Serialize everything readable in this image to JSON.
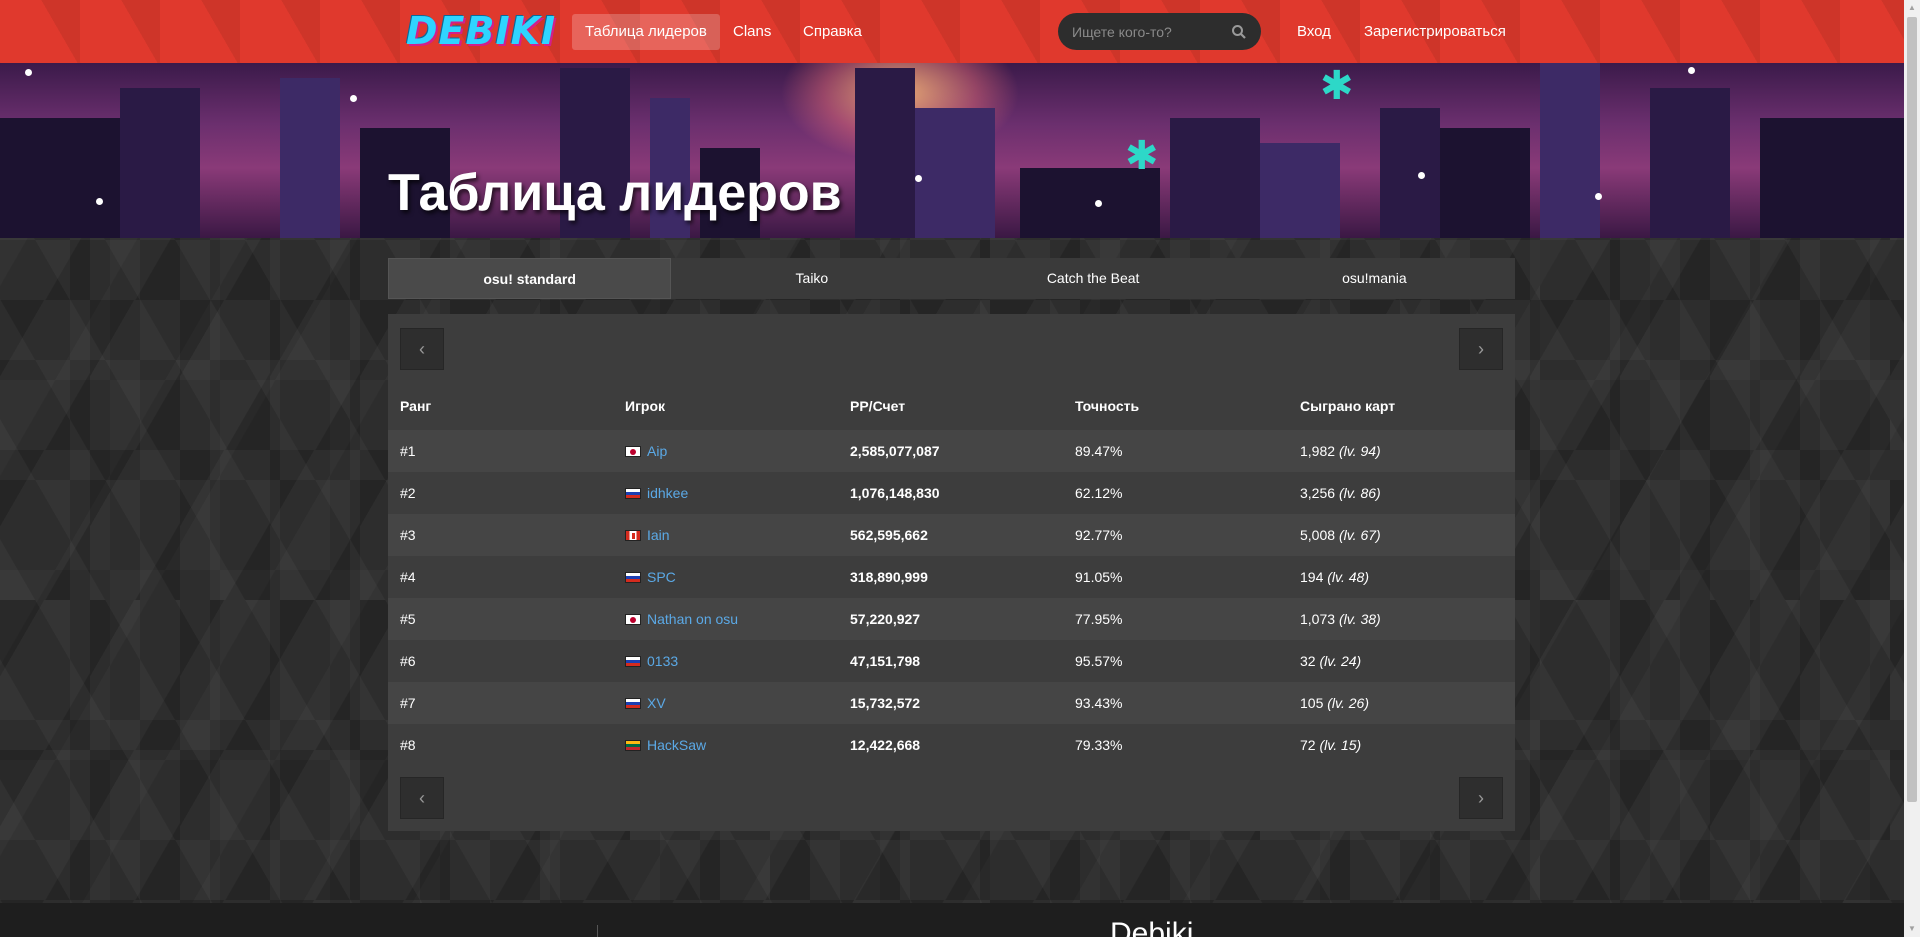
{
  "nav": {
    "logo": "DEBIKI",
    "links": [
      "Таблица лидеров",
      "Clans",
      "Справка"
    ],
    "search_placeholder": "Ищете кого-то?",
    "login": "Вход",
    "register": "Зарегистрироваться"
  },
  "hero": {
    "title": "Таблица лидеров"
  },
  "modes": [
    "osu! standard",
    "Taiko",
    "Catch the Beat",
    "osu!mania"
  ],
  "table": {
    "headers": [
      "Ранг",
      "Игрок",
      "PP/Счет",
      "Точность",
      "Сыграно карт"
    ],
    "rows": [
      {
        "rank": "#1",
        "flag": "jp",
        "player": "Aip",
        "score": "2,585,077,087",
        "accuracy": "89.47%",
        "plays": "1,982",
        "level": "(lv. 94)"
      },
      {
        "rank": "#2",
        "flag": "ru",
        "player": "idhkee",
        "score": "1,076,148,830",
        "accuracy": "62.12%",
        "plays": "3,256",
        "level": "(lv. 86)"
      },
      {
        "rank": "#3",
        "flag": "ca",
        "player": "Iain",
        "score": "562,595,662",
        "accuracy": "92.77%",
        "plays": "5,008",
        "level": "(lv. 67)"
      },
      {
        "rank": "#4",
        "flag": "ru",
        "player": "SPC",
        "score": "318,890,999",
        "accuracy": "91.05%",
        "plays": "194",
        "level": "(lv. 48)"
      },
      {
        "rank": "#5",
        "flag": "jp",
        "player": "Nathan on osu",
        "score": "57,220,927",
        "accuracy": "77.95%",
        "plays": "1,073",
        "level": "(lv. 38)"
      },
      {
        "rank": "#6",
        "flag": "ru",
        "player": "0133",
        "score": "47,151,798",
        "accuracy": "95.57%",
        "plays": "32",
        "level": "(lv. 24)"
      },
      {
        "rank": "#7",
        "flag": "ru",
        "player": "XV",
        "score": "15,732,572",
        "accuracy": "93.43%",
        "plays": "105",
        "level": "(lv. 26)"
      },
      {
        "rank": "#8",
        "flag": "lt",
        "player": "HackSaw",
        "score": "12,422,668",
        "accuracy": "79.33%",
        "plays": "72",
        "level": "(lv. 15)"
      }
    ]
  },
  "footer": {
    "title": "Debiki"
  },
  "colors": {
    "navbar": "#e0392d",
    "link": "#5ba9e6",
    "background": "#2d2d2d"
  }
}
